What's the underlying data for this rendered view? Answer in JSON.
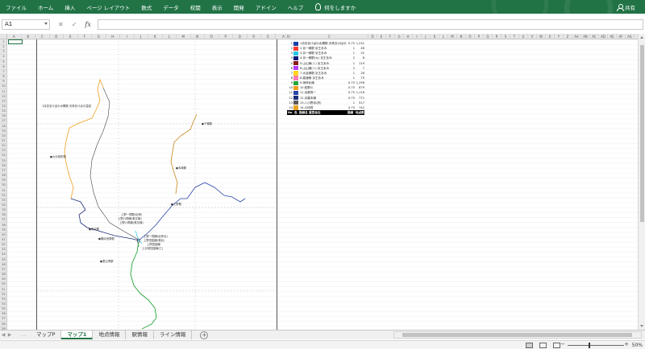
{
  "ribbon": {
    "tabs": [
      "ファイル",
      "ホーム",
      "挿入",
      "ページ レイアウト",
      "数式",
      "データ",
      "校閲",
      "表示",
      "開発",
      "アドイン",
      "ヘルプ"
    ],
    "tell_me": "何をしますか",
    "share": "共有",
    "accent": "#217346"
  },
  "formula_bar": {
    "name_box": "A1",
    "cancel": "✕",
    "enter": "✓",
    "fx": "fx",
    "content": ""
  },
  "columns_left": [
    "A",
    "B",
    "C",
    "D",
    "E",
    "F",
    "G",
    "H",
    "I",
    "J",
    "K",
    "L",
    "M",
    "N",
    "O",
    "P",
    "Q",
    "R",
    "S"
  ],
  "columns_right": [
    "A",
    "B",
    "C",
    "D",
    "E",
    "F",
    "G",
    "H",
    "I",
    "J",
    "K",
    "L",
    "M",
    "N",
    "O",
    "P",
    "Q",
    "R",
    "S",
    "T",
    "U",
    "V",
    "W",
    "X",
    "Y",
    "Z",
    "AA",
    "AB",
    "AC",
    "AD",
    "AE",
    "AF",
    "AG",
    "AH",
    "AI",
    "AJ",
    "AK",
    "AL",
    "AM",
    "AN",
    "AO"
  ],
  "rows": [
    "1",
    "2",
    "3",
    "4",
    "5",
    "6",
    "7",
    "8",
    "9",
    "10",
    "11",
    "12",
    "13",
    "14",
    "15",
    "16",
    "17",
    "18",
    "19",
    "20",
    "21",
    "22",
    "23",
    "24",
    "25",
    "26",
    "27",
    "28",
    "29",
    "30",
    "31",
    "32",
    "33",
    "34",
    "35",
    "36",
    "37",
    "38",
    "39",
    "40",
    "41",
    "42",
    "43",
    "44",
    "45",
    "46",
    "47",
    "48",
    "49",
    "50",
    "51",
    "52",
    "53",
    "54",
    "55",
    "56",
    "57",
    "58",
    "59"
  ],
  "map_labels": [
    "1月初あけぼの水郷駅-天峡あけぼの温泉",
    "●大分岐町駅",
    "●千葉駅",
    "●末崎駅",
    "●上野駅",
    "上野一関駅(紀伊)",
    "上野六関線(美文線)",
    "上野六関線(美文線)",
    "●東京駅",
    "上野一関線(紀伊北)",
    "上野田園線(美北)",
    "上関田園線",
    "上分岐田園線(仁)",
    "●横浜田原駅",
    "●恵比寿駅"
  ],
  "legend": {
    "header": [
      "No",
      "色",
      "路線名 運営会社",
      "路線キロ",
      "地点数"
    ],
    "rows": [
      {
        "no": "1",
        "color": "#1a3ea8",
        "name": "1月初あけぼの水郷駅-天峡あけぼの温泉",
        "len": "0.75",
        "pts": "1,231"
      },
      {
        "no": "2",
        "color": "#ff3b2f",
        "name": "2.京一線駅 京王あみ",
        "len": "1",
        "pts": "46"
      },
      {
        "no": "3",
        "color": "#25c6e8",
        "name": "3.京一線駅 京王あみ",
        "len": "1",
        "pts": "32"
      },
      {
        "no": "4",
        "color": "#0a1a7a",
        "name": "4.京一線駅(キ) 京王あみ",
        "len": "2",
        "pts": "8"
      },
      {
        "no": "5",
        "color": "#8a1a1a",
        "name": "5.山山線(ト) 京王あみ",
        "len": "1",
        "pts": "119"
      },
      {
        "no": "6",
        "color": "#b53dff",
        "name": "6.山山線(ハ) 京王あみ",
        "len": "2",
        "pts": "7"
      },
      {
        "no": "7",
        "color": "#ffd51f",
        "name": "7.大谷線駅 京王あみ",
        "len": "1",
        "pts": "28"
      },
      {
        "no": "8",
        "color": "#ff7ab4",
        "name": "8.高速線 京王あみ",
        "len": "1",
        "pts": "79"
      },
      {
        "no": "9",
        "color": "#26a63a",
        "name": "9.海岸北線",
        "len": "0.75",
        "pts": "1,296"
      },
      {
        "no": "10",
        "color": "#f29c1d",
        "name": "10.松野川",
        "len": "0.75",
        "pts": "879"
      },
      {
        "no": "11",
        "color": "#2a45a8",
        "name": "11.京都府一",
        "len": "0.75",
        "pts": "1,116"
      },
      {
        "no": "12",
        "color": "#1c2d7a",
        "name": "12.京葉本線",
        "len": "0.75",
        "pts": "771"
      },
      {
        "no": "13",
        "color": "#5a5a5a",
        "name": "13.八小野寺(府)",
        "len": "1",
        "pts": "517"
      },
      {
        "no": "14",
        "color": "#e8a21d",
        "name": "14.小田府",
        "len": "0.75",
        "pts": "742"
      }
    ]
  },
  "sheet_tabs": [
    "マップP",
    "マップ1",
    "地点情報",
    "駅情報",
    "ライン情報"
  ],
  "active_sheet": "マップ1",
  "status": {
    "zoom": "50%"
  }
}
